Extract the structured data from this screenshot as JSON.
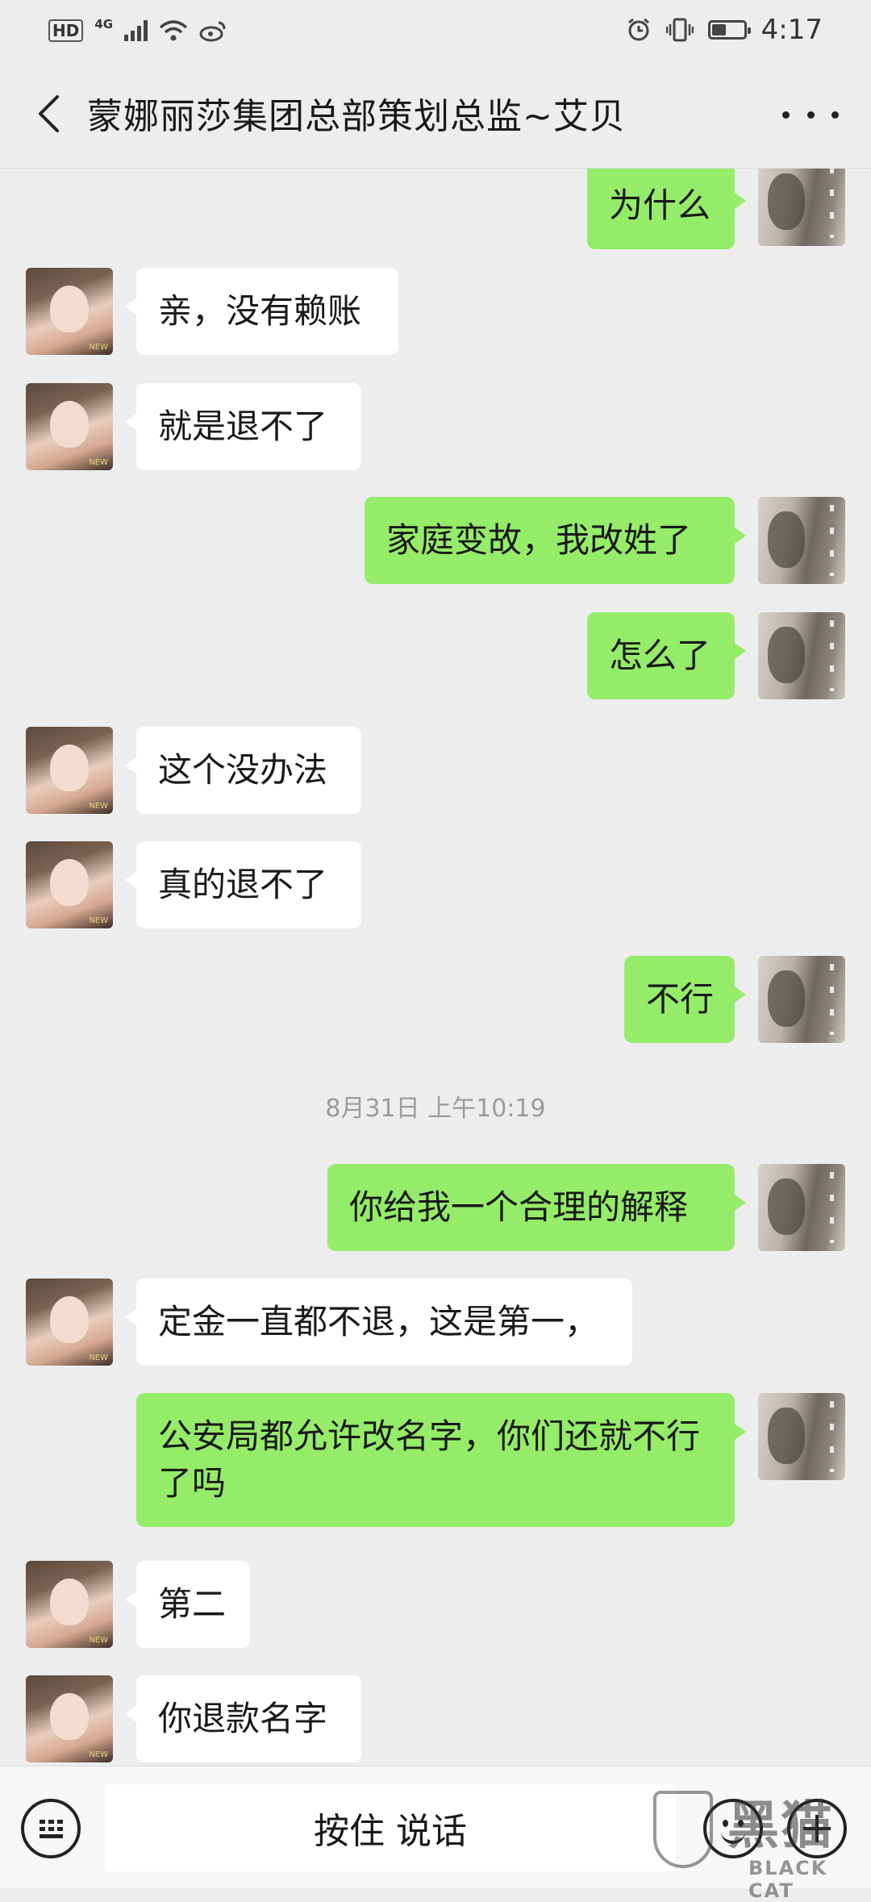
{
  "status_bar": {
    "hd_label": "HD",
    "network_label": "4G",
    "time": "4:17",
    "icons": [
      "signal-icon",
      "wifi-icon",
      "weibo-icon",
      "alarm-icon",
      "vibrate-icon",
      "battery-icon"
    ],
    "battery_level": 0.45
  },
  "header": {
    "title": "蒙娜丽莎集团总部策划总监~艾贝",
    "back_icon": "chevron-left-icon",
    "more_icon": "more-dots-icon"
  },
  "messages": [
    {
      "side": "out",
      "text": "为什么"
    },
    {
      "side": "in",
      "text": "亲，没有赖账"
    },
    {
      "side": "in",
      "text": "就是退不了"
    },
    {
      "side": "out",
      "text": "家庭变故，我改姓了"
    },
    {
      "side": "out",
      "text": "怎么了"
    },
    {
      "side": "in",
      "text": "这个没办法"
    },
    {
      "side": "in",
      "text": "真的退不了"
    },
    {
      "side": "out",
      "text": "不行"
    },
    {
      "side": "out",
      "text": "你给我一个合理的解释"
    },
    {
      "side": "in",
      "text": "定金一直都不退，这是第一，"
    },
    {
      "side": "out",
      "text": "公安局都允许改名字，你们还就不行了吗"
    },
    {
      "side": "in",
      "text": "第二"
    },
    {
      "side": "in",
      "text": "你退款名字"
    }
  ],
  "timestamp": "8月31日 上午10:19",
  "input_bar": {
    "hold_to_talk": "按住 说话",
    "keyboard_icon": "keyboard-icon",
    "emoji_icon": "emoji-icon",
    "plus_icon": "plus-icon"
  },
  "watermark": {
    "cn": "黑猫",
    "en": "BLACK CAT"
  },
  "colors": {
    "background": "#ededed",
    "incoming_bubble": "#ffffff",
    "outgoing_bubble": "#95ec69",
    "timestamp": "#9b9b9b"
  }
}
